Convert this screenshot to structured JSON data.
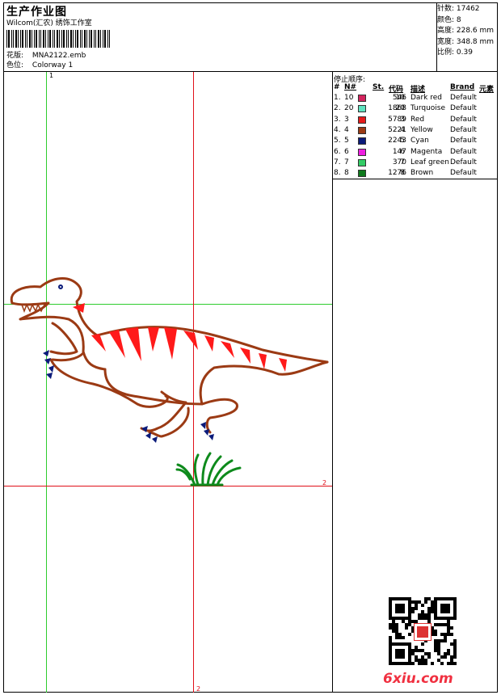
{
  "header": {
    "title": "生产作业图",
    "subtitle": "Wilcom(汇农) 绣饰工作室",
    "design_label": "花版:",
    "design_value": "MNA2122.emb",
    "colorway_label": "色位:",
    "colorway_value": "Colorway 1"
  },
  "stats": {
    "stitches": "针数: 17462",
    "colors": "颜色: 8",
    "height": "高度: 228.6 mm",
    "width": "宽度: 348.8 mm",
    "scale": "比例: 0.39"
  },
  "legend": {
    "heading": "停止顺序:",
    "columns": {
      "num": "#",
      "needle": "N#",
      "st": "St.",
      "code": "代码",
      "desc": "描述",
      "brand": "Brand",
      "elem": "元素"
    },
    "rows": [
      {
        "num": "1.",
        "needle": "10",
        "color": "#d4245e",
        "st": "546",
        "code": "10",
        "desc": "Dark red",
        "brand": "Default"
      },
      {
        "num": "2.",
        "needle": "20",
        "color": "#5fe3c0",
        "st": "1868",
        "code": "20",
        "desc": "Turquoise",
        "brand": "Default"
      },
      {
        "num": "3.",
        "needle": "3",
        "color": "#e61a1a",
        "st": "5789",
        "code": "3",
        "desc": "Red",
        "brand": "Default"
      },
      {
        "num": "4.",
        "needle": "4",
        "color": "#9b3a14",
        "st": "5221",
        "code": "4",
        "desc": "Yellow",
        "brand": "Default"
      },
      {
        "num": "5.",
        "needle": "5",
        "color": "#0b1b7a",
        "st": "2243",
        "code": "5",
        "desc": "Cyan",
        "brand": "Default"
      },
      {
        "num": "6.",
        "needle": "6",
        "color": "#ee1ee0",
        "st": "147",
        "code": "6",
        "desc": "Magenta",
        "brand": "Default"
      },
      {
        "num": "7.",
        "needle": "7",
        "color": "#33cc66",
        "st": "370",
        "code": "7",
        "desc": "Leaf green",
        "brand": "Default"
      },
      {
        "num": "8.",
        "needle": "8",
        "color": "#0e7a1c",
        "st": "1276",
        "code": "8",
        "desc": "Brown",
        "brand": "Default"
      }
    ]
  },
  "guides": {
    "label_top": "1",
    "label_right": "2",
    "label_bottom": "2"
  },
  "watermark": "6xiu.com",
  "colors": {
    "outline": "#9b3a14",
    "stripes": "#ff1a1a",
    "claws": "#0b1b7a",
    "grass": "#0e8a1c",
    "guide_green": "#2ecc2e",
    "guide_red": "#e0101a"
  }
}
